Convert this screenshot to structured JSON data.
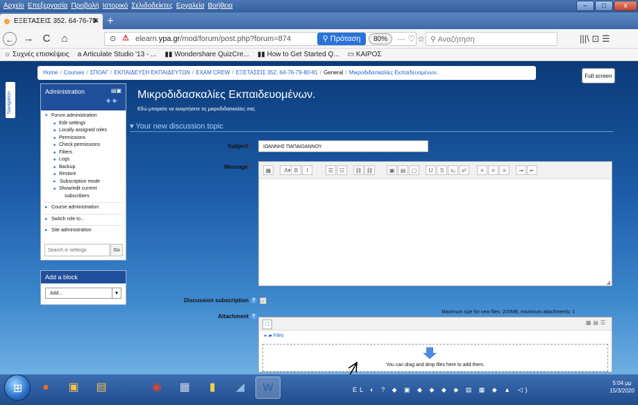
{
  "menu": [
    "Αρχείο",
    "Επεξεργασία",
    "Προβολή",
    "Ιστορικό",
    "Σελιδοδείκτες",
    "Εργαλεία",
    "Βοήθεια"
  ],
  "window_controls": {
    "minimize": "–",
    "maximize": "□",
    "close": "x"
  },
  "tab": {
    "title": "ΕΞΕΤΑΣΕΙΣ 352. 64-76-79-80-81",
    "close": "✕"
  },
  "newtab": "+",
  "nav": {
    "back": "←",
    "forward": "→",
    "reload": "C",
    "home": "⌂",
    "url_prefix": "elearn.",
    "url_host": "ypa.gr",
    "url_path": "/mod/forum/post.php?forum=874",
    "proposal": "Πρόταση",
    "zoom": "80%",
    "url_icons": "··· ♡ ☆",
    "search_placeholder": "Αναζήτηση",
    "right_icons": "|||\\  ⊡  ☰"
  },
  "bookmarks": [
    "Συχνές επισκέψεις",
    "Articulate Studio '13 - ...",
    "Wondershare QuizCre...",
    "How to Get Started Q...",
    "ΚΑΙΡΟΣ"
  ],
  "breadcrumb": [
    "Home",
    "Courses",
    "ΣΠΟΑΓ",
    "ΕΚΠΑΙΔΕΥΣΗ ΕΚΠΑΙΔΕΥΤΩΝ",
    "EXAM CREW",
    "ΕΞΕΤΑΣΕΙΣ 352. 64-76-79-80-81",
    "General",
    "Μικροδιδασκαλίες Εκπαιδευομένων."
  ],
  "fullscreen": "Full screen",
  "navigation_tab": "Navigation",
  "admin": {
    "title": "Administration",
    "items": [
      {
        "label": "Forum administration",
        "level": 1,
        "marker": "▾"
      },
      {
        "label": "Edit settings",
        "level": 2,
        "marker": "■"
      },
      {
        "label": "Locally assigned roles",
        "level": 2,
        "marker": "■"
      },
      {
        "label": "Permissions",
        "level": 2,
        "marker": "■"
      },
      {
        "label": "Check permissions",
        "level": 2,
        "marker": "■"
      },
      {
        "label": "Filters",
        "level": 2,
        "marker": "■"
      },
      {
        "label": "Logs",
        "level": 2,
        "marker": "■"
      },
      {
        "label": "Backup",
        "level": 2,
        "marker": "■"
      },
      {
        "label": "Restore",
        "level": 2,
        "marker": "■"
      },
      {
        "label": "Subscription mode",
        "level": 2,
        "marker": "▸"
      },
      {
        "label": "Show/edit current",
        "level": 2,
        "marker": "■"
      },
      {
        "label": "subscribers",
        "level": 3,
        "marker": ""
      },
      {
        "label": "Course administration",
        "level": 1,
        "marker": "▸"
      },
      {
        "label": "Switch role to...",
        "level": 1,
        "marker": "▸"
      },
      {
        "label": "Site administration",
        "level": 1,
        "marker": "▸"
      }
    ],
    "search_placeholder": "Search in settings",
    "go": "Go"
  },
  "addblock": {
    "title": "Add a block",
    "select": "Add..."
  },
  "forum": {
    "title": "Μικροδιδασκαλίες Εκπαιδευομένων.",
    "subtitle": "Εδώ μπορείτε να αναρτήσετε τις μικροδιδασκαλίες σας.",
    "new_topic": "Your new discussion topic",
    "subject_label": "Subject",
    "subject_value": "ΙΩΑΝΝΗΣ ΠΑΠΑΙΩΑΝΝΟΥ",
    "message_label": "Message",
    "subscription_label": "Discussion subscription",
    "attachment_label": "Attachment",
    "max_size": "Maximum size for new files: 200MB, maximum attachments: 1",
    "files_path": "Files",
    "drop_text": "You can drag and drop files here to add them.",
    "required_mark": "*"
  },
  "editor_buttons": [
    "▦",
    "A▾",
    "B",
    "I",
    "☰",
    "☷",
    "⛓",
    "⛓",
    "▣",
    "▤",
    "▢",
    "U",
    "S",
    "x₂",
    "x²",
    "≡",
    "≡",
    "≡",
    "⇥",
    "⇤"
  ],
  "taskbar": {
    "start": "⊞",
    "apps": [
      "●",
      "▣",
      "▤",
      "▶",
      "◉",
      "▦",
      "▮",
      "◢",
      "W"
    ],
    "tray": "EL ◐ ? ◆ ▣ ◆ ◆ ◆ ◆ ▤ ▦ ◆ ▲ ◁)",
    "time": "5:04 μμ",
    "date": "15/3/2020"
  }
}
